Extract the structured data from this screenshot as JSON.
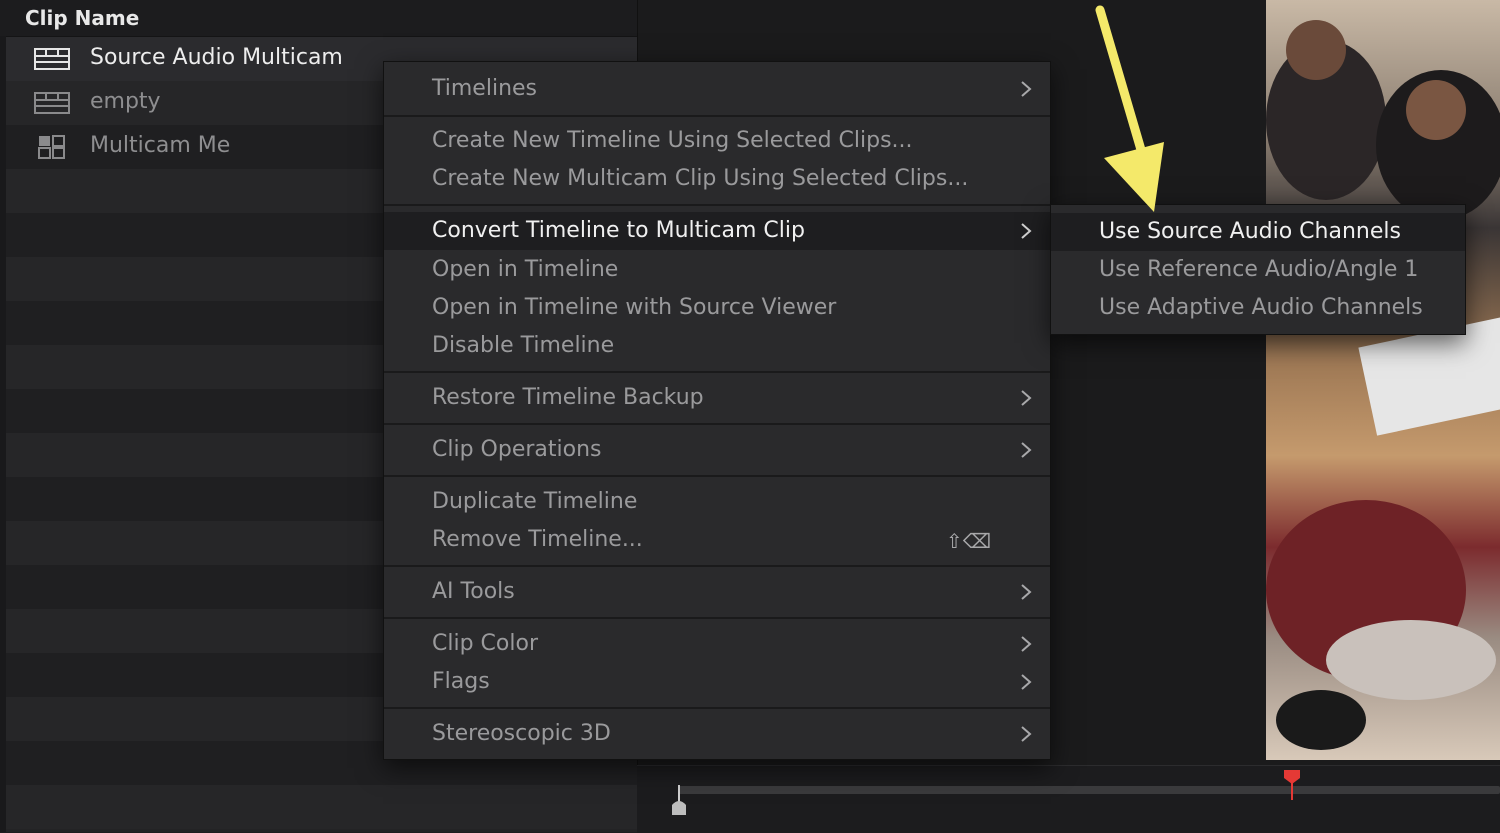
{
  "pool": {
    "header": "Clip Name",
    "clips": [
      {
        "name": "Source Audio Multicam",
        "icon": "timeline-icon"
      },
      {
        "name": "empty",
        "icon": "timeline-icon"
      },
      {
        "name": "Multicam Me",
        "icon": "multicam-icon"
      }
    ]
  },
  "menu": {
    "timelines": "Timelines",
    "create_new_timeline": "Create New Timeline Using Selected Clips...",
    "create_new_multicam": "Create New Multicam Clip Using Selected Clips...",
    "convert_to_multicam": "Convert Timeline to Multicam Clip",
    "open_in_timeline": "Open in Timeline",
    "open_with_source_viewer": "Open in Timeline with Source Viewer",
    "disable_timeline": "Disable Timeline",
    "restore_backup": "Restore Timeline Backup",
    "clip_operations": "Clip Operations",
    "duplicate_timeline": "Duplicate Timeline",
    "remove_timeline": "Remove Timeline...",
    "remove_shortcut": "⇧⌫",
    "ai_tools": "AI Tools",
    "clip_color": "Clip Color",
    "flags": "Flags",
    "stereoscopic": "Stereoscopic 3D",
    "chevron_icon": "chevron-right-icon"
  },
  "submenu": {
    "items": [
      "Use Source Audio Channels",
      "Use Reference Audio/Angle 1",
      "Use Adaptive Audio Channels"
    ]
  },
  "colors": {
    "annotation_arrow": "#f4e96a",
    "marker": "#e53935",
    "menu_bg": "#2a2a2c",
    "highlight": "#1e1e20"
  }
}
